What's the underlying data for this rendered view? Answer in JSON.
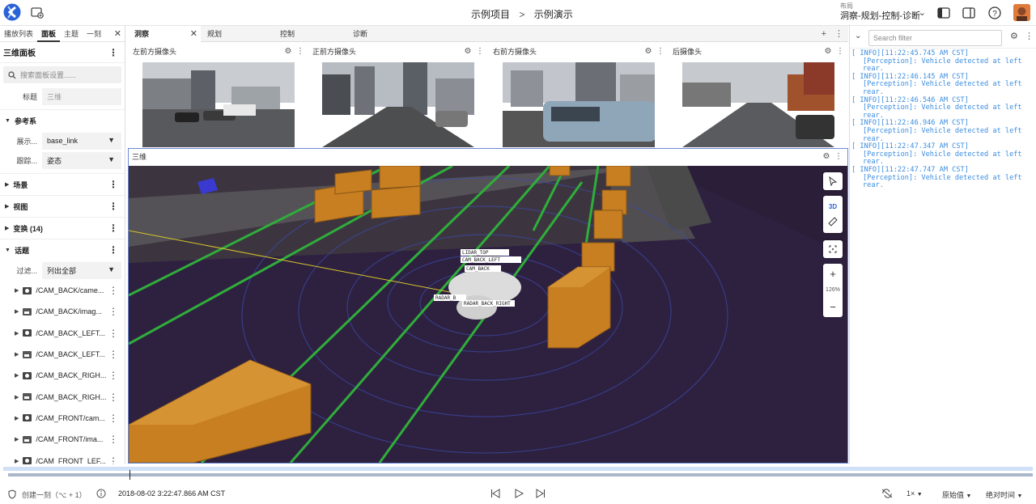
{
  "header": {
    "breadcrumb_project": "示例项目",
    "breadcrumb_sep": ">",
    "breadcrumb_item": "示例演示",
    "layout_small": "布局",
    "layout_name": "洞察-规划-控制-诊断"
  },
  "left_panel": {
    "tabs": [
      "播放列表",
      "面板",
      "主题",
      "一刻"
    ],
    "active_tab": "面板",
    "title": "三维面板",
    "search_placeholder": "搜索面板设置......",
    "title_label": "标题",
    "title_value": "三维",
    "sections": {
      "ref": "参考系",
      "display_label": "展示...",
      "display_value": "base_link",
      "track_label": "跟踪...",
      "track_value": "姿态",
      "scene": "场景",
      "view": "视图",
      "transform": "变换 (14)",
      "topics": "话题",
      "filter_label": "过滤...",
      "filter_value": "列出全部"
    },
    "topics": [
      {
        "name": "/CAM_BACK/came...",
        "icon": "camera-icon"
      },
      {
        "name": "/CAM_BACK/imag...",
        "icon": "image-icon"
      },
      {
        "name": "/CAM_BACK_LEFT...",
        "icon": "camera-icon"
      },
      {
        "name": "/CAM_BACK_LEFT...",
        "icon": "image-icon"
      },
      {
        "name": "/CAM_BACK_RIGH...",
        "icon": "camera-icon"
      },
      {
        "name": "/CAM_BACK_RIGH...",
        "icon": "image-icon"
      },
      {
        "name": "/CAM_FRONT/cam...",
        "icon": "camera-icon"
      },
      {
        "name": "/CAM_FRONT/ima...",
        "icon": "image-icon"
      },
      {
        "name": "/CAM_FRONT_LEF...",
        "icon": "camera-icon"
      }
    ]
  },
  "main_tabs": [
    "洞察",
    "规划",
    "控制",
    "诊断"
  ],
  "cameras": [
    "左前方摄像头",
    "正前方摄像头",
    "右前方摄像头",
    "后摄像头"
  ],
  "panel3d": {
    "title": "三维",
    "mode": "3D",
    "zoom": "126%",
    "zoom_in": "+",
    "zoom_out": "−",
    "labels": [
      "LIDAR_TOP",
      "CAM_BACK_LEFT",
      "CAM_BACK",
      "RADAR_B",
      "RADAR_BACK_RIGHT"
    ]
  },
  "right_panel": {
    "search_placeholder": "Search filter",
    "logs": [
      {
        "time": "[ INFO][11:22:45.745 AM CST]",
        "msg": "[Perception]: Vehicle detected at left rear."
      },
      {
        "time": "[ INFO][11:22:46.145 AM CST]",
        "msg": "[Perception]: Vehicle detected at left rear."
      },
      {
        "time": "[ INFO][11:22:46.546 AM CST]",
        "msg": "[Perception]: Vehicle detected at left rear."
      },
      {
        "time": "[ INFO][11:22:46.946 AM CST]",
        "msg": "[Perception]: Vehicle detected at left rear."
      },
      {
        "time": "[ INFO][11:22:47.347 AM CST]",
        "msg": "[Perception]: Vehicle detected at left rear."
      },
      {
        "time": "[ INFO][11:22:47.747 AM CST]",
        "msg": "[Perception]: Vehicle detected at left rear."
      }
    ]
  },
  "playback": {
    "create_moment": "创建一刻（⌥ + 1）",
    "timestamp": "2018-08-02 3:22:47.866 AM CST",
    "speed": "1×",
    "source": "原始值",
    "time_mode": "绝对时间"
  },
  "colors": {
    "accent": "#3b78e7",
    "log_text": "#3b8de0",
    "box_orange": "#d68a2b",
    "viz_bg": "#2b1f3a"
  }
}
